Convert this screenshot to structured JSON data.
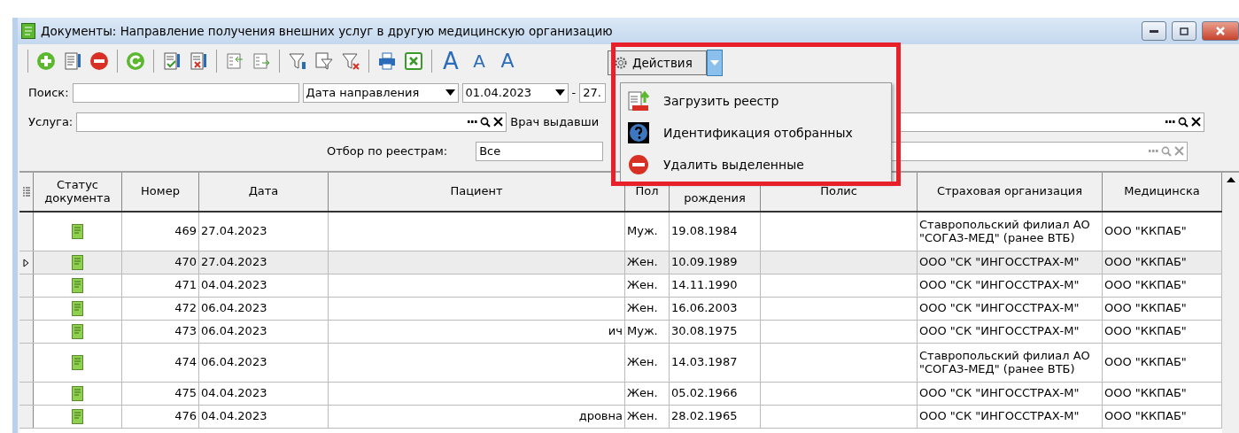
{
  "window": {
    "title": "Документы: Направление получения внешних услуг в другую медицинскую организацию"
  },
  "font_buttons": [
    "A",
    "A",
    "A"
  ],
  "actions_button": {
    "label": "Действия",
    "expanded": true
  },
  "actions_menu": [
    {
      "label": "Загрузить реестр",
      "kind": "upload"
    },
    {
      "label": "Идентификация отобранных",
      "kind": "help"
    },
    {
      "label": "Удалить выделенные",
      "kind": "delete"
    }
  ],
  "search": {
    "label": "Поиск:",
    "date_type": "Дата направления",
    "date_from": "01.04.2023",
    "date_sep": "-",
    "date_to": "27."
  },
  "service": {
    "label": "Услуга:",
    "doctor_label": "Врач выдавши"
  },
  "registry_filter": {
    "label": "Отбор по реестрам:",
    "value": "Все",
    "disabled_field": true
  },
  "table": {
    "columns": [
      "Статус документа",
      "Номер",
      "Дата",
      "Пациент",
      "Пол",
      "рождения",
      "Полис",
      "Страховая организация",
      "Медицинска"
    ],
    "rows": [
      {
        "number": "469",
        "date": "27.04.2023",
        "patient": "",
        "sex": "Муж.",
        "birth": "19.08.1984",
        "insurer": "Ставропольский филиал АО \"СОГАЗ-МЕД\" (ранее ВТБ)",
        "org": "ООО \"ККПАБ\"",
        "selected": false,
        "tall": true
      },
      {
        "number": "470",
        "date": "27.04.2023",
        "patient": "",
        "sex": "Жен.",
        "birth": "10.09.1989",
        "insurer": "ООО \"СК \"ИНГОССТРАХ-М\"",
        "org": "ООО \"ККПАБ\"",
        "selected": true,
        "tall": false
      },
      {
        "number": "471",
        "date": "04.04.2023",
        "patient": "",
        "sex": "Жен.",
        "birth": "14.11.1990",
        "insurer": "ООО \"СК \"ИНГОССТРАХ-М\"",
        "org": "ООО \"ККПАБ\"",
        "selected": false,
        "tall": false
      },
      {
        "number": "472",
        "date": "06.04.2023",
        "patient": "",
        "sex": "Жен.",
        "birth": "16.06.2003",
        "insurer": "ООО \"СК \"ИНГОССТРАХ-М\"",
        "org": "ООО \"ККПАБ\"",
        "selected": false,
        "tall": false
      },
      {
        "number": "473",
        "date": "06.04.2023",
        "patient": "ич",
        "sex": "Муж.",
        "birth": "30.08.1975",
        "insurer": "ООО \"СК \"ИНГОССТРАХ-М\"",
        "org": "ООО \"ККПАБ\"",
        "selected": false,
        "tall": false
      },
      {
        "number": "474",
        "date": "06.04.2023",
        "patient": "",
        "sex": "Жен.",
        "birth": "14.03.1987",
        "insurer": "Ставропольский филиал АО \"СОГАЗ-МЕД\" (ранее ВТБ)",
        "org": "ООО \"ККПАБ\"",
        "selected": false,
        "tall": true
      },
      {
        "number": "475",
        "date": "04.04.2023",
        "patient": "",
        "sex": "Жен.",
        "birth": "05.02.1966",
        "insurer": "ООО \"СК \"ИНГОССТРАХ-М\"",
        "org": "ООО \"ККПАБ\"",
        "selected": false,
        "tall": false
      },
      {
        "number": "476",
        "date": "04.04.2023",
        "patient": "дровна",
        "sex": "Жен.",
        "birth": "28.02.1965",
        "insurer": "ООО \"СК \"ИНГОССТРАХ-М\"",
        "org": "ООО \"ККПАБ\"",
        "selected": false,
        "tall": false
      }
    ]
  }
}
